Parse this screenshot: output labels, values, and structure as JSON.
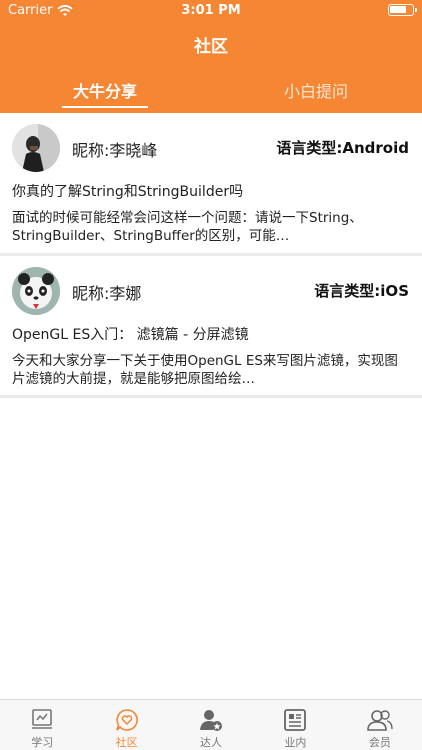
{
  "status_bar": {
    "carrier": "Carrier",
    "time": "3:01 PM"
  },
  "nav": {
    "title": "社区"
  },
  "tabs": [
    {
      "label": "大牛分享",
      "active": true
    },
    {
      "label": "小白提问",
      "active": false
    }
  ],
  "posts": [
    {
      "nickname": "昵称:李晓峰",
      "language": "语言类型:Android",
      "title": "你真的了解String和StringBuilder吗",
      "summary": "面试的时候可能经常会问这样一个问题：请说一下String、StringBuilder、StringBuffer的区别，可能…"
    },
    {
      "nickname": "昵称:李娜",
      "language": "语言类型:iOS",
      "title": "OpenGL ES入门： 滤镜篇 - 分屏滤镜",
      "summary": "今天和大家分享一下关于使用OpenGL ES来写图片滤镜，实现图片滤镜的大前提，就是能够把原图给绘…"
    }
  ],
  "tabbar": [
    {
      "label": "学习",
      "icon": "study-icon",
      "active": false
    },
    {
      "label": "社区",
      "icon": "community-icon",
      "active": true
    },
    {
      "label": "达人",
      "icon": "expert-icon",
      "active": false
    },
    {
      "label": "业内",
      "icon": "news-icon",
      "active": false
    },
    {
      "label": "会员",
      "icon": "members-icon",
      "active": false
    }
  ],
  "colors": {
    "accent": "#f58634",
    "inactive": "#777777"
  }
}
